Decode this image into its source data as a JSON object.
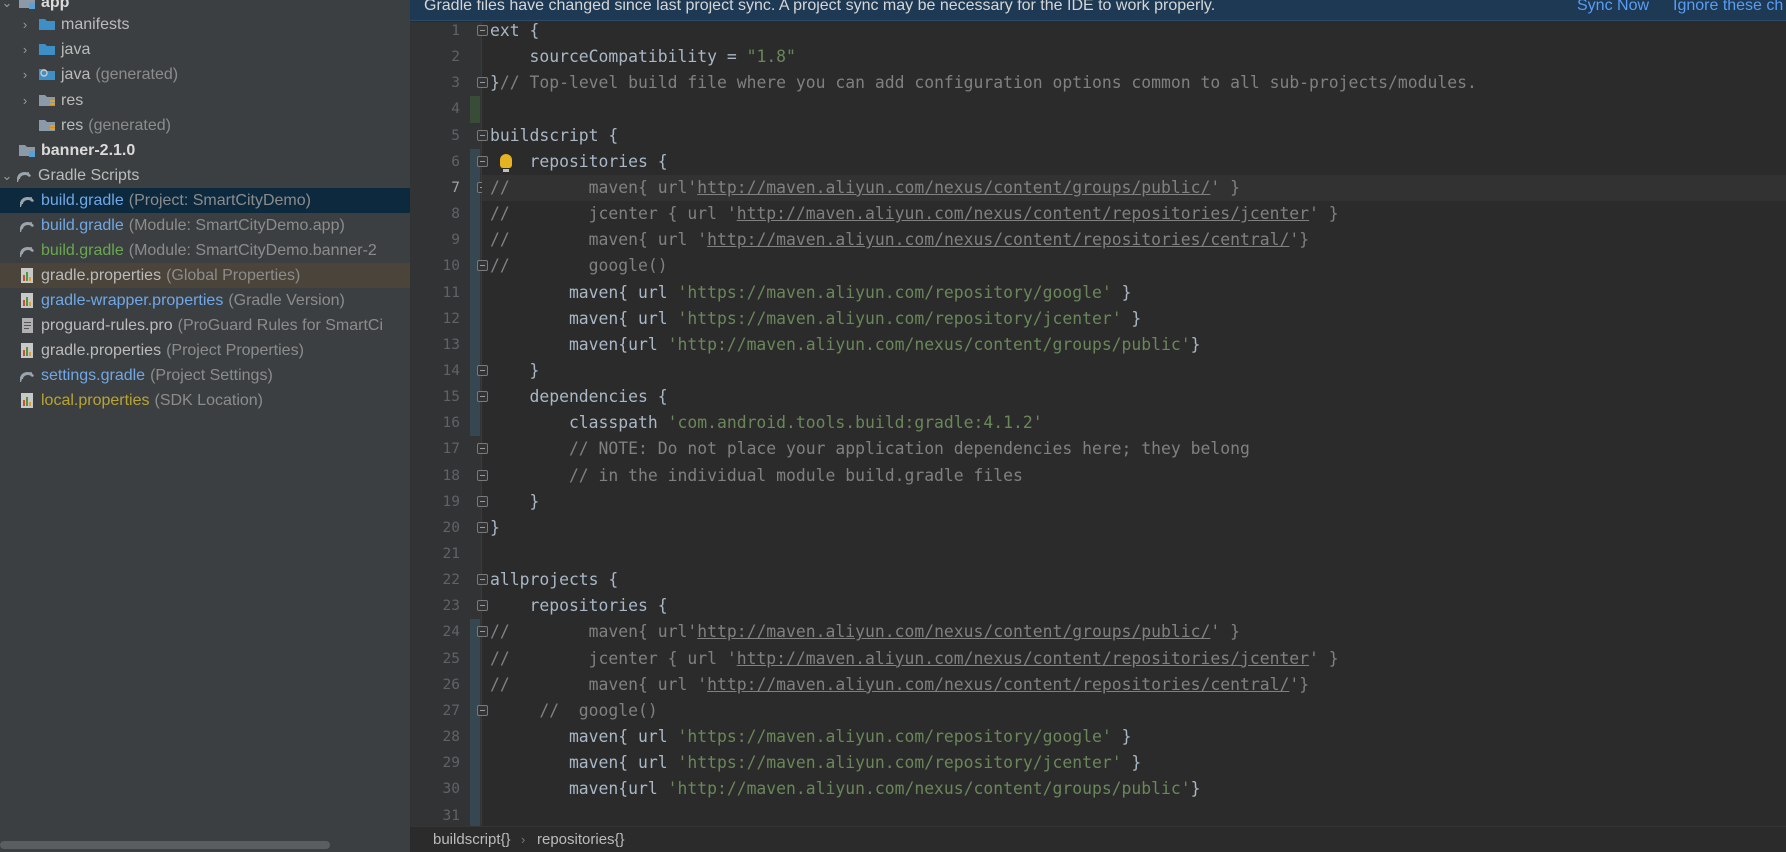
{
  "tree": {
    "items": [
      {
        "label": "app",
        "suffix": "",
        "icon": "module-folder-icon",
        "arrow": "expanded",
        "style": "bold"
      },
      {
        "label": "manifests",
        "suffix": "",
        "icon": "folder-icon",
        "arrow": "collapsed",
        "style": ""
      },
      {
        "label": "java",
        "suffix": "",
        "icon": "folder-icon",
        "arrow": "collapsed",
        "style": ""
      },
      {
        "label": "java",
        "suffix": "(generated)",
        "icon": "generated-folder-icon",
        "arrow": "collapsed",
        "style": ""
      },
      {
        "label": "res",
        "suffix": "",
        "icon": "resources-folder-icon",
        "arrow": "collapsed",
        "style": ""
      },
      {
        "label": "res",
        "suffix": "(generated)",
        "icon": "resources-folder-icon",
        "arrow": "",
        "style": ""
      },
      {
        "label": "banner-2.1.0",
        "suffix": "",
        "icon": "module-folder-icon",
        "arrow": "",
        "style": "bold"
      },
      {
        "label": "Gradle Scripts",
        "suffix": "",
        "icon": "gradle-icon",
        "arrow": "expanded",
        "style": ""
      },
      {
        "label": "build.gradle",
        "suffix": "(Project: SmartCityDemo)",
        "icon": "gradle-icon",
        "arrow": "",
        "style": "blue"
      },
      {
        "label": "build.gradle",
        "suffix": "(Module: SmartCityDemo.app)",
        "icon": "gradle-icon",
        "arrow": "",
        "style": "blue"
      },
      {
        "label": "build.gradle",
        "suffix": "(Module: SmartCityDemo.banner-2",
        "icon": "gradle-icon",
        "arrow": "",
        "style": "green"
      },
      {
        "label": "gradle.properties",
        "suffix": "(Global Properties)",
        "icon": "properties-icon",
        "arrow": "",
        "style": ""
      },
      {
        "label": "gradle-wrapper.properties",
        "suffix": "(Gradle Version)",
        "icon": "properties-icon",
        "arrow": "",
        "style": "blue"
      },
      {
        "label": "proguard-rules.pro",
        "suffix": "(ProGuard Rules for SmartCi",
        "icon": "text-file-icon",
        "arrow": "",
        "style": ""
      },
      {
        "label": "gradle.properties",
        "suffix": "(Project Properties)",
        "icon": "properties-icon",
        "arrow": "",
        "style": ""
      },
      {
        "label": "settings.gradle",
        "suffix": "(Project Settings)",
        "icon": "gradle-icon",
        "arrow": "",
        "style": "blue"
      },
      {
        "label": "local.properties",
        "suffix": "(SDK Location)",
        "icon": "properties-icon",
        "arrow": "",
        "style": "yellow"
      }
    ],
    "selected_index": 8,
    "highlighted_index": 11
  },
  "banner": {
    "message": "Gradle files have changed since last project sync. A project sync may be necessary for the IDE to work properly.",
    "sync_label": "Sync Now",
    "ignore_label": "Ignore these ch"
  },
  "editor": {
    "current_line": 7,
    "lines": [
      {
        "n": "1",
        "segs": [
          [
            "ext {",
            ""
          ]
        ]
      },
      {
        "n": "2",
        "segs": [
          [
            "    sourceCompatibility = ",
            ""
          ],
          [
            "\"1.8\"",
            "str"
          ]
        ]
      },
      {
        "n": "3",
        "segs": [
          [
            "}",
            ""
          ],
          [
            "// Top-level build file where you can add configuration options common to all sub-projects/modules.",
            "cm"
          ]
        ]
      },
      {
        "n": "4",
        "segs": []
      },
      {
        "n": "5",
        "segs": [
          [
            "buildscript {",
            ""
          ]
        ]
      },
      {
        "n": "6",
        "segs": [
          [
            "    repositories {",
            ""
          ]
        ]
      },
      {
        "n": "7",
        "segs": [
          [
            "//        maven{ url'",
            "cm"
          ],
          [
            "http://maven.aliyun.com/nexus/content/groups/public/",
            "cmurl"
          ],
          [
            "' }",
            "cm"
          ]
        ]
      },
      {
        "n": "8",
        "segs": [
          [
            "//        jcenter { url '",
            "cm"
          ],
          [
            "http://maven.aliyun.com/nexus/content/repositories/jcenter",
            "cmurl"
          ],
          [
            "' }",
            "cm"
          ]
        ]
      },
      {
        "n": "9",
        "segs": [
          [
            "//        maven{ url '",
            "cm"
          ],
          [
            "http://maven.aliyun.com/nexus/content/repositories/central/",
            "cmurl"
          ],
          [
            "'}",
            "cm"
          ]
        ]
      },
      {
        "n": "10",
        "segs": [
          [
            "//        google()",
            "cm"
          ]
        ]
      },
      {
        "n": "11",
        "segs": [
          [
            "        maven{ url ",
            ""
          ],
          [
            "'https://maven.aliyun.com/repository/google'",
            "str"
          ],
          [
            " }",
            ""
          ]
        ]
      },
      {
        "n": "12",
        "segs": [
          [
            "        maven{ url ",
            ""
          ],
          [
            "'https://maven.aliyun.com/repository/jcenter'",
            "str"
          ],
          [
            " }",
            ""
          ]
        ]
      },
      {
        "n": "13",
        "segs": [
          [
            "        maven{url ",
            ""
          ],
          [
            "'http://maven.aliyun.com/nexus/content/groups/public'",
            "str"
          ],
          [
            "}",
            ""
          ]
        ]
      },
      {
        "n": "14",
        "segs": [
          [
            "    }",
            ""
          ]
        ]
      },
      {
        "n": "15",
        "segs": [
          [
            "    dependencies {",
            ""
          ]
        ]
      },
      {
        "n": "16",
        "segs": [
          [
            "        classpath ",
            ""
          ],
          [
            "'com.android.tools.build:gradle:4.1.2'",
            "str"
          ]
        ]
      },
      {
        "n": "17",
        "segs": [
          [
            "        // NOTE: Do not place your application dependencies here; they belong",
            "cm"
          ]
        ]
      },
      {
        "n": "18",
        "segs": [
          [
            "        // in the individual module build.gradle files",
            "cm"
          ]
        ]
      },
      {
        "n": "19",
        "segs": [
          [
            "    }",
            ""
          ]
        ]
      },
      {
        "n": "20",
        "segs": [
          [
            "}",
            ""
          ]
        ]
      },
      {
        "n": "21",
        "segs": []
      },
      {
        "n": "22",
        "segs": [
          [
            "allprojects {",
            ""
          ]
        ]
      },
      {
        "n": "23",
        "segs": [
          [
            "    repositories {",
            ""
          ]
        ]
      },
      {
        "n": "24",
        "segs": [
          [
            "//        maven{ url'",
            "cm"
          ],
          [
            "http://maven.aliyun.com/nexus/content/groups/public/",
            "cmurl"
          ],
          [
            "' }",
            "cm"
          ]
        ]
      },
      {
        "n": "25",
        "segs": [
          [
            "//        jcenter { url '",
            "cm"
          ],
          [
            "http://maven.aliyun.com/nexus/content/repositories/jcenter",
            "cmurl"
          ],
          [
            "' }",
            "cm"
          ]
        ]
      },
      {
        "n": "26",
        "segs": [
          [
            "//        maven{ url '",
            "cm"
          ],
          [
            "http://maven.aliyun.com/nexus/content/repositories/central/",
            "cmurl"
          ],
          [
            "'}",
            "cm"
          ]
        ]
      },
      {
        "n": "27",
        "segs": [
          [
            "     //  google()",
            "cm"
          ]
        ]
      },
      {
        "n": "28",
        "segs": [
          [
            "        maven{ url ",
            ""
          ],
          [
            "'https://maven.aliyun.com/repository/google'",
            "str"
          ],
          [
            " }",
            ""
          ]
        ]
      },
      {
        "n": "29",
        "segs": [
          [
            "        maven{ url ",
            ""
          ],
          [
            "'https://maven.aliyun.com/repository/jcenter'",
            "str"
          ],
          [
            " }",
            ""
          ]
        ]
      },
      {
        "n": "30",
        "segs": [
          [
            "        maven{url ",
            ""
          ],
          [
            "'http://maven.aliyun.com/nexus/content/groups/public'",
            "str"
          ],
          [
            "}",
            ""
          ]
        ]
      },
      {
        "n": "31",
        "segs": []
      }
    ],
    "fold_lines": [
      1,
      3,
      5,
      6,
      7,
      10,
      14,
      15,
      17,
      18,
      19,
      20,
      22,
      23,
      24,
      27
    ],
    "intention_bulb_line": 6
  },
  "breadcrumb": {
    "items": [
      "buildscript{}",
      "repositories{}"
    ],
    "separator": "›"
  },
  "colors": {
    "keyword_default": "#a9b7c6",
    "comment": "#808080",
    "string": "#6a8759",
    "link": "#589df6"
  }
}
